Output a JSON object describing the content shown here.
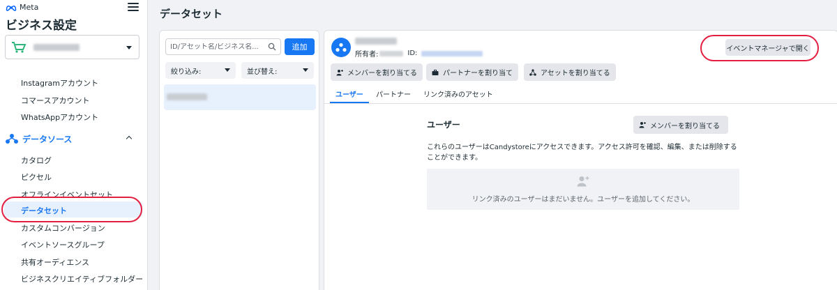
{
  "brand": {
    "logo_text": "Meta"
  },
  "sidebar": {
    "title": "ビジネス設定",
    "items": [
      {
        "label": "Instagramアカウント"
      },
      {
        "label": "コマースアカウント"
      },
      {
        "label": "WhatsAppアカウント"
      }
    ],
    "section": {
      "label": "データソース"
    },
    "sub_items": [
      {
        "label": "カタログ"
      },
      {
        "label": "ピクセル"
      },
      {
        "label": "オフラインイベントセット"
      },
      {
        "label": "データセット"
      },
      {
        "label": "カスタムコンバージョン"
      },
      {
        "label": "イベントソースグループ"
      },
      {
        "label": "共有オーディエンス"
      },
      {
        "label": "ビジネスクリエイティブフォルダー"
      }
    ]
  },
  "page": {
    "title": "データセット"
  },
  "list": {
    "search_placeholder": "ID/アセット名/ビジネス名...",
    "add_label": "追加",
    "filter_label": "絞り込み:",
    "sort_label": "並び替え:"
  },
  "detail": {
    "owner_label": "所有者:",
    "id_label": "ID:",
    "open_button": "イベントマネージャで開く",
    "assign_members": "メンバーを割り当てる",
    "assign_partners": "パートナーを割り当て",
    "assign_assets": "アセットを割り当てる",
    "tabs": [
      {
        "label": "ユーザー"
      },
      {
        "label": "パートナー"
      },
      {
        "label": "リンク済みのアセット"
      }
    ],
    "section_title": "ユーザー",
    "section_assign": "メンバーを割り当てる",
    "description": "これらのユーザーはCandystoreにアクセスできます。アクセス許可を確認、編集、または削除することができます。",
    "empty_text": "リンク済みのユーザーはまだいません。ユーザーを追加してください。"
  },
  "colors": {
    "accent": "#1877f2",
    "highlight": "#e41e3f",
    "cart": "#2fb67c"
  }
}
